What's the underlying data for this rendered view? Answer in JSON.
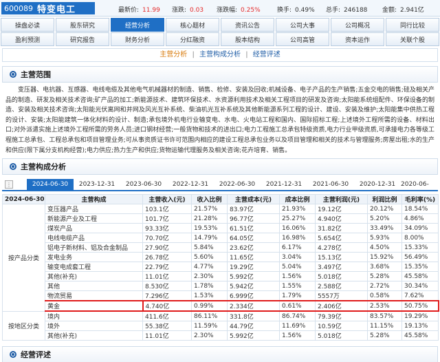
{
  "header": {
    "code": "600089",
    "name": "特变电工",
    "quotes": [
      {
        "label": "最新价:",
        "value": "11.99",
        "color": "red"
      },
      {
        "label": "涨跌:",
        "value": "0.03",
        "color": "red"
      },
      {
        "label": "涨跌幅:",
        "value": "0.25%",
        "color": "red"
      },
      {
        "label": "换手:",
        "value": "0.49%",
        "color": ""
      },
      {
        "label": "总手:",
        "value": "246188",
        "color": ""
      },
      {
        "label": "金额:",
        "value": "2.941亿",
        "color": ""
      }
    ]
  },
  "nav": {
    "row1": [
      "操盘必读",
      "股东研究",
      "经营分析",
      "核心题材",
      "资讯公告",
      "公司大事",
      "公司概况",
      "同行比较"
    ],
    "row2": [
      "盈利预测",
      "研究报告",
      "财务分析",
      "分红融资",
      "股本结构",
      "公司高管",
      "资本运作",
      "关联个股"
    ],
    "active": "经营分析"
  },
  "subnav": {
    "items": [
      "主营分析",
      "主营构成分析",
      "经营评述"
    ],
    "separator": "|"
  },
  "scope": {
    "title": "主营范围",
    "text": "变压器、电抗器、互感器、电线电缆及其他电气机械器材的制造、销售、检修、安装及回收;机械设备、电子产品的生产销售;五金交电的销售;硅及相关产品的制造、研发及相关技术咨询;矿产品的加工;新能源技术、建筑环保技术、水资源利用技术及相关工程项目的研发及咨询;太阳能系统组配件、环保设备的制造、安装及相关技术咨询;太阳能光伏离网和并网及风光互补系统、柴油机光互补系统及其他新能源系列工程的设计、建设、安装及维护;太阳能集中供热工程的设计、安装;太阳能建筑一体化材料的设计、制造;承包境外机电行业输变电、水电、火电站工程和国内、国际招标工程;上述境外工程所需的设备、材料出口;对外派遣实施上述境外工程所需的劳务人员;进口钢材经营;一般货物和技术的进出口;电力工程施工总承包特级资质,电力行业甲级资质,可承接电力各等级工程施工总承包、工程总承包和项目管理业务;可从事资质证书许可范围内相应的建设工程总承包业务以及项目管理和相关的技术与管理服务;房屋出租;水的生产和供应(限下属分支机构经营);电力供应;热力生产和供应;货物运输代理服务及相关咨询;花卉培育、销售。"
  },
  "composition": {
    "title": "主营构成分析",
    "periods": [
      "2024-06-30",
      "2023-12-31",
      "2023-06-30",
      "2022-12-31",
      "2022-06-30",
      "2021-12-31",
      "2021-06-30",
      "2020-12-31",
      "2020-06-"
    ],
    "active_period": "2024-06-30",
    "columns": [
      "2024-06-30",
      "主营构成",
      "主营收入(元)",
      "收入比例",
      "主营成本(元)",
      "成本比例",
      "主营利润(元)",
      "利润比例",
      "毛利率(%)"
    ],
    "groups": [
      {
        "label": "按产品分类",
        "rows": [
          [
            "变压器产品",
            "103.1亿",
            "21.57%",
            "83.97亿",
            "21.93%",
            "19.12亿",
            "20.12%",
            "18.54%"
          ],
          [
            "新能源产业及工程",
            "101.7亿",
            "21.28%",
            "96.77亿",
            "25.27%",
            "4.940亿",
            "5.20%",
            "4.86%"
          ],
          [
            "煤炭产品",
            "93.33亿",
            "19.53%",
            "61.51亿",
            "16.06%",
            "31.82亿",
            "33.49%",
            "34.09%"
          ],
          [
            "电线电缆产品",
            "70.70亿",
            "14.79%",
            "64.05亿",
            "16.98%",
            "5.654亿",
            "5.93%",
            "8.00%"
          ],
          [
            "铝电子新材料、铝及合金制品",
            "27.90亿",
            "5.84%",
            "23.62亿",
            "6.17%",
            "4.278亿",
            "4.50%",
            "15.33%"
          ],
          [
            "发电业务",
            "26.78亿",
            "5.60%",
            "11.65亿",
            "3.04%",
            "15.13亿",
            "15.92%",
            "56.49%"
          ],
          [
            "输变电成套工程",
            "22.79亿",
            "4.77%",
            "19.29亿",
            "5.04%",
            "3.497亿",
            "3.68%",
            "15.35%"
          ],
          [
            "其他(补充)",
            "11.01亿",
            "2.30%",
            "5.992亿",
            "1.56%",
            "5.018亿",
            "5.28%",
            "45.58%"
          ],
          [
            "其他",
            "8.530亿",
            "1.78%",
            "5.942亿",
            "1.55%",
            "2.588亿",
            "2.72%",
            "30.34%"
          ],
          [
            "物流贸易",
            "7.296亿",
            "1.53%",
            "6.999亿",
            "1.79%",
            "5557万",
            "0.58%",
            "7.62%"
          ],
          [
            "黄金",
            "4.740亿",
            "0.99%",
            "2.334亿",
            "0.61%",
            "2.406亿",
            "2.53%",
            "50.75%"
          ]
        ]
      },
      {
        "label": "按地区分类",
        "rows": [
          [
            "境内",
            "411.6亿",
            "86.11%",
            "331.8亿",
            "86.74%",
            "79.39亿",
            "83.57%",
            "19.29%"
          ],
          [
            "境外",
            "55.38亿",
            "11.59%",
            "44.79亿",
            "11.69%",
            "10.59亿",
            "11.15%",
            "19.13%"
          ],
          [
            "其他(补充)",
            "11.01亿",
            "2.30%",
            "5.992亿",
            "1.56%",
            "5.018亿",
            "5.28%",
            "45.58%"
          ]
        ]
      }
    ],
    "highlight_row": "黄金"
  },
  "review": {
    "title": "经营评述"
  },
  "colors": {
    "accent": "#1f6fc5",
    "quote_red": "#e52a2a",
    "highlight_border": "#e01a1a",
    "subnav_active": "#d87b0c"
  }
}
